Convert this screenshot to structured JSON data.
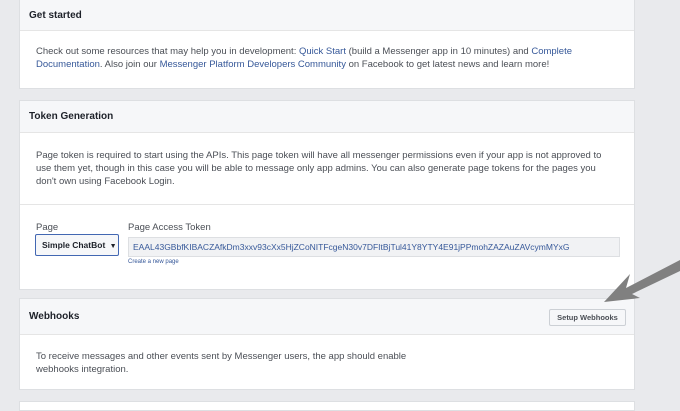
{
  "get_started": {
    "title": "Get started",
    "text_1": "Check out some resources that may help you in development: ",
    "quick_start": "Quick Start",
    "text_2": " (build a Messenger app in 10 minutes) and ",
    "complete_documentation": "Complete Documentation",
    "text_3": ". Also join our ",
    "community": "Messenger Platform Developers Community",
    "text_4": " on Facebook to get latest news and learn more!"
  },
  "token_generation": {
    "title": "Token Generation",
    "description": "Page token is required to start using the APIs. This page token will have all messenger permissions even if your app is not approved to use them yet, though in this case you will be able to message only app admins. You can also generate page tokens for the pages you don't own using Facebook Login.",
    "page_label": "Page",
    "page_selected": "Simple ChatBot",
    "token_label": "Page Access Token",
    "token_value": "EAAL43GBbfKIBACZAfkDm3xxv93cXx5HjZCoNITFcgeN30v7DFItBjTul41Y8YTY4E91jPPmohZAZAuZAVcymMYxG",
    "create_page_link": "Create a new page"
  },
  "webhooks": {
    "title": "Webhooks",
    "setup_button": "Setup Webhooks",
    "description": "To receive messages and other events sent by Messenger users, the app should enable webhooks integration."
  },
  "icons": {
    "dropdown": "chevron-down-icon",
    "annotation": "arrow-pointer-icon"
  },
  "colors": {
    "link": "#365899",
    "select_border": "#4267b2",
    "arrow": "#808080"
  }
}
